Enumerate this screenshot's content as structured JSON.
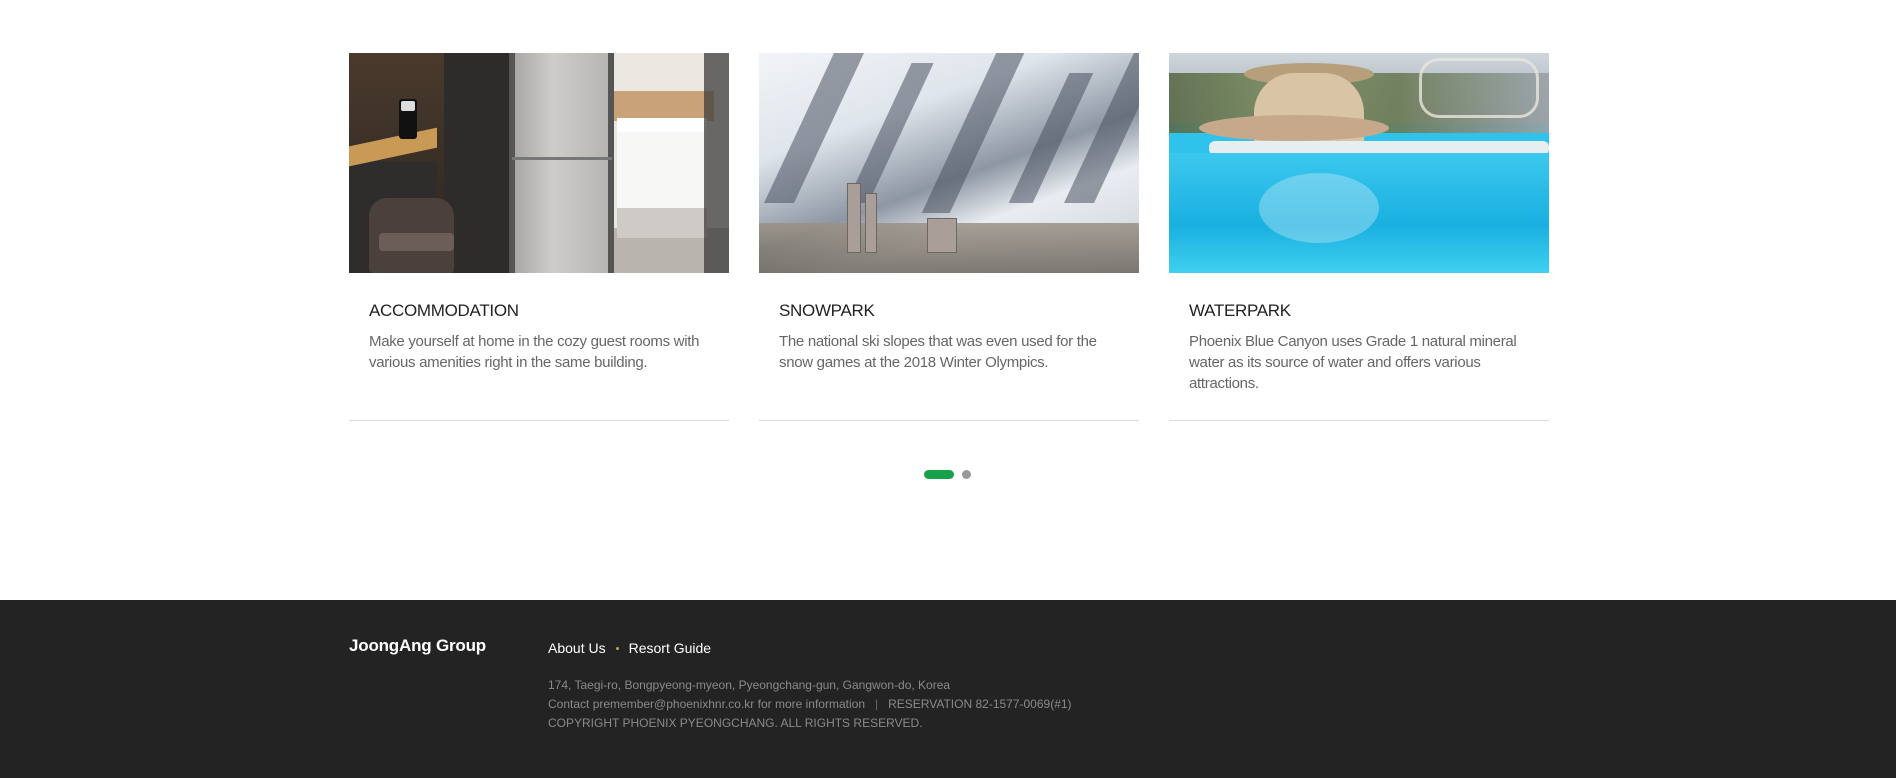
{
  "cards": [
    {
      "title": "ACCOMMODATION",
      "description": "Make yourself at home in the cozy guest rooms with various amenities right in the same building."
    },
    {
      "title": "SNOWPARK",
      "description": "The national ski slopes that was even used for the snow games at the 2018 Winter Olympics."
    },
    {
      "title": "WATERPARK",
      "description": "Phoenix Blue Canyon uses Grade 1 natural mineral water as its source of water and offers various attractions."
    }
  ],
  "pager": {
    "active_index": 0,
    "count": 2,
    "active_color": "#16a14a",
    "inactive_color": "#999999"
  },
  "footer": {
    "logo": "JoongAng Group",
    "links": [
      "About Us",
      "Resort Guide"
    ],
    "address": "174, Taegi-ro, Bongpyeong-myeon, Pyeongchang-gun, Gangwon-do, Korea",
    "contact": "Contact premember@phoenixhnr.co.kr for more information",
    "reservation": "RESERVATION 82-1577-0069(#1)",
    "copyright": "COPYRIGHT PHOENIX PYEONGCHANG. ALL RIGHTS RESERVED."
  }
}
